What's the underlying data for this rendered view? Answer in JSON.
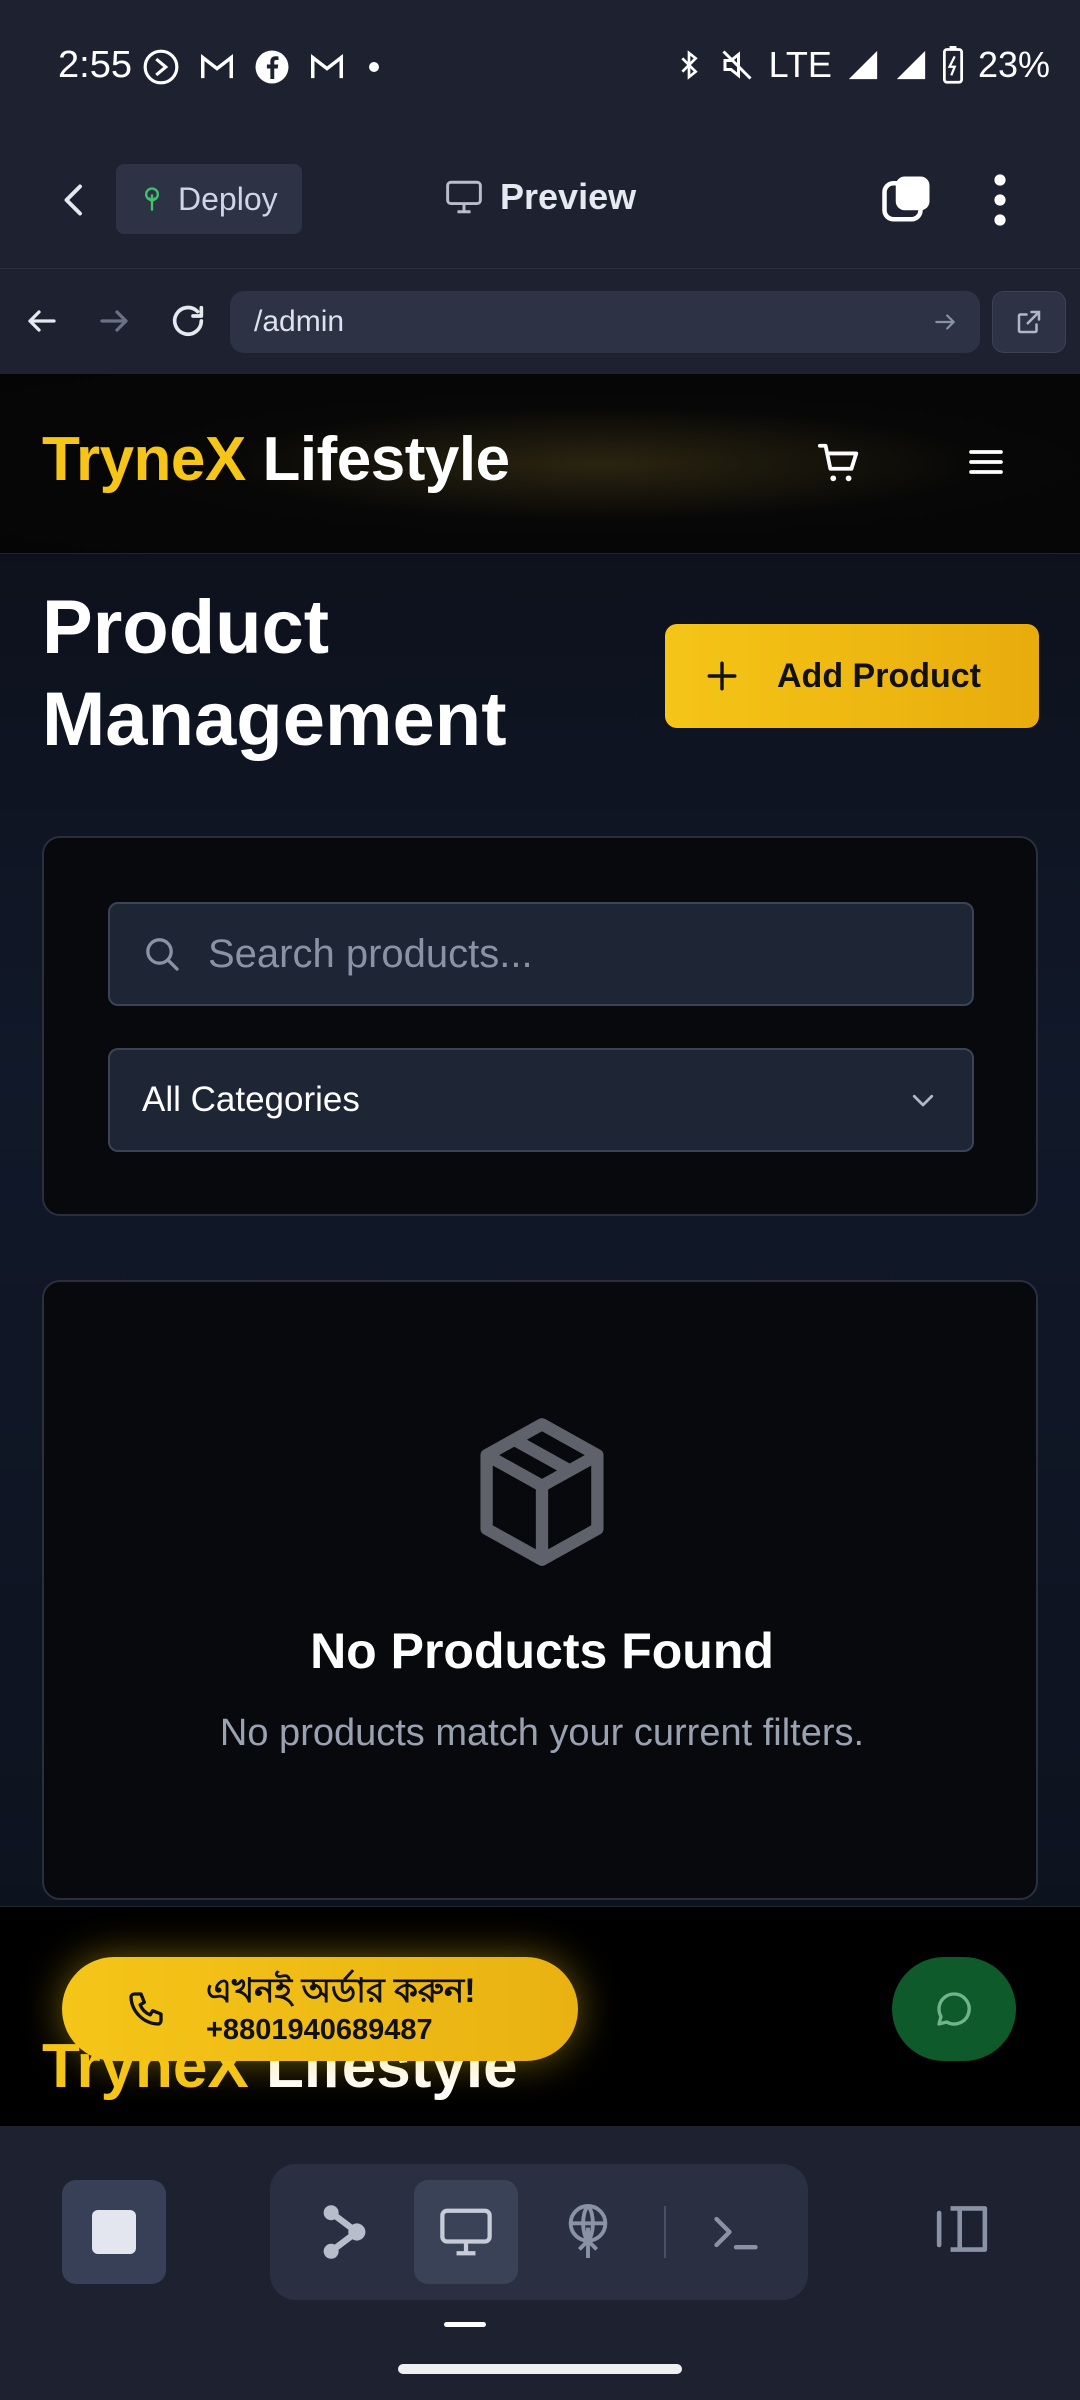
{
  "status_bar": {
    "time": "2:55",
    "network": "LTE",
    "battery": "23%"
  },
  "toolbar": {
    "deploy_label": "Deploy",
    "preview_label": "Preview"
  },
  "url_bar": {
    "url": "/admin"
  },
  "site": {
    "brand_yellow": "TryneX",
    "brand_white": "Lifestyle",
    "page_title": "Product Management",
    "add_button": "Add Product",
    "search_placeholder": "Search products...",
    "category_selected": "All Categories",
    "empty_title": "No Products Found",
    "empty_subtitle": "No products match your current filters.",
    "footer_brand_yellow": "TryneX",
    "footer_brand_white": "Lifestyle",
    "order_line1": "এখনই অর্ডার করুন!",
    "order_phone": "+8801940689487"
  },
  "colors": {
    "accent": "#f5c518",
    "chat_green": "#0e5a2b",
    "app_bg": "#1e2230"
  },
  "icons": [
    "back-chevron-icon",
    "tree-icon",
    "monitor-icon",
    "tabs-icon",
    "more-vert-icon",
    "arrow-left-icon",
    "arrow-right-icon",
    "reload-icon",
    "go-arrow-icon",
    "open-external-icon",
    "cart-icon",
    "menu-icon",
    "plus-icon",
    "search-icon",
    "chevron-down-icon",
    "package-icon",
    "phone-icon",
    "chat-icon",
    "stop-icon",
    "agent-icon",
    "desktop-icon",
    "globe-icon",
    "terminal-icon",
    "panel-icon"
  ]
}
